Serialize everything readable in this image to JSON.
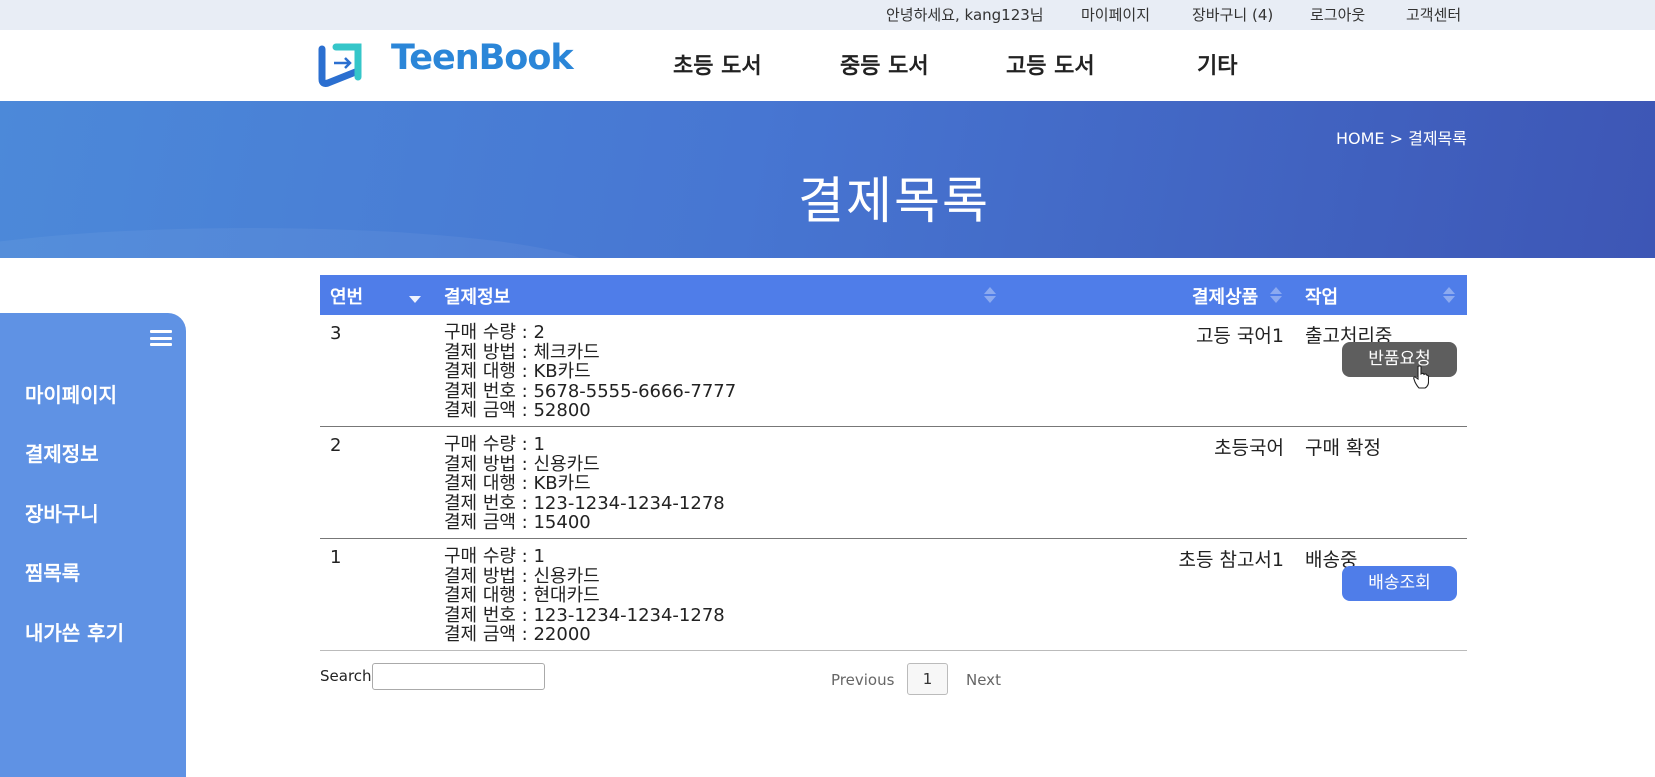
{
  "topbar": {
    "greeting": "안녕하세요, kang123님",
    "mypage": "마이페이지",
    "cart": "장바구니 (4)",
    "logout": "로그아웃",
    "support": "고객센터"
  },
  "header": {
    "logo_text": "TeenBook",
    "nav": [
      "초등 도서",
      "중등 도서",
      "고등 도서",
      "기타"
    ]
  },
  "banner": {
    "breadcrumb": "HOME > 결제목록",
    "title": "결제목록"
  },
  "sidebar": {
    "menu_icon": "hamburger-icon",
    "items": [
      "마이페이지",
      "결제정보",
      "장바구니",
      "찜목록",
      "내가쓴 후기"
    ]
  },
  "table": {
    "headers": [
      "연번",
      "결제정보",
      "결제상품",
      "작업"
    ],
    "rows": [
      {
        "num": "3",
        "info": [
          "구매 수량 : 2",
          "결제 방법 : 체크카드",
          "결제 대행 : KB카드",
          "결제 번호 : 5678-5555-6666-7777",
          "결제 금액 : 52800"
        ],
        "product": "고등 국어1",
        "status": "출고처리중",
        "button": "반품요청"
      },
      {
        "num": "2",
        "info": [
          "구매 수량 : 1",
          "결제 방법 : 신용카드",
          "결제 대행 : KB카드",
          "결제 번호 : 123-1234-1234-1278",
          "결제 금액 : 15400"
        ],
        "product": "초등국어",
        "status": "구매 확정",
        "button": ""
      },
      {
        "num": "1",
        "info": [
          "구매 수량 : 1",
          "결제 방법 : 신용카드",
          "결제 대행 : 현대카드",
          "결제 번호 : 123-1234-1234-1278",
          "결제 금액 : 22000"
        ],
        "product": "초등 참고서1",
        "status": "배송중",
        "button": "배송조회"
      }
    ]
  },
  "search": {
    "label": "Search:",
    "value": ""
  },
  "pagination": {
    "previous": "Previous",
    "page": "1",
    "next": "Next"
  },
  "colors": {
    "accent": "#4f7de9",
    "sidebar": "#5f92e4",
    "banner_start": "#4c89d9",
    "banner_end": "#3d56b5",
    "button_gray": "#5e5e5e"
  }
}
